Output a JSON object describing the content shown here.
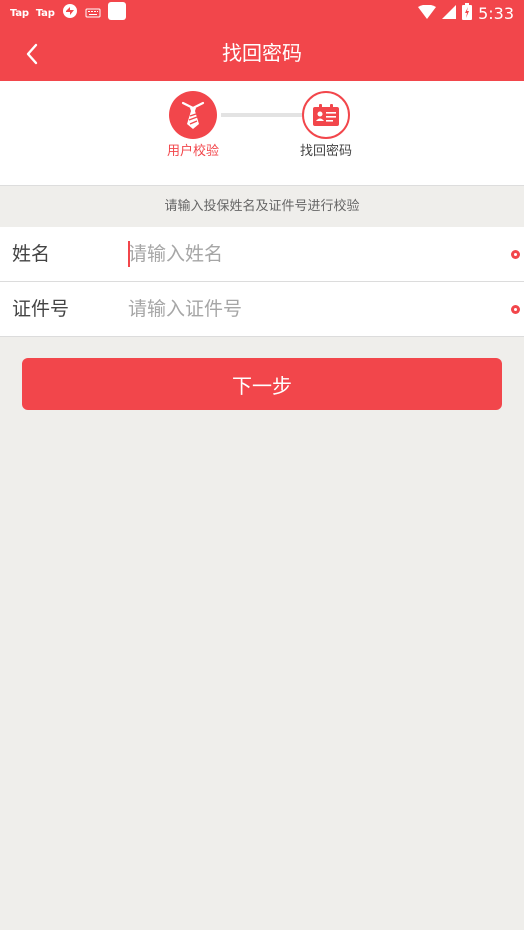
{
  "status_bar": {
    "notifications": [
      "Tap",
      "Tap"
    ],
    "time": "5:33"
  },
  "header": {
    "title": "找回密码"
  },
  "steps": [
    {
      "label": "用户校验",
      "state": "active",
      "icon": "tie-icon"
    },
    {
      "label": "找回密码",
      "state": "inactive",
      "icon": "id-card-icon"
    }
  ],
  "hint": "请输入投保姓名及证件号进行校验",
  "form": {
    "name_label": "姓名",
    "name_value": "",
    "name_placeholder": "请输入姓名",
    "id_label": "证件号",
    "id_value": "",
    "id_placeholder": "请输入证件号"
  },
  "next_button": "下一步",
  "colors": {
    "primary": "#f2464b",
    "background": "#efeeeb"
  }
}
